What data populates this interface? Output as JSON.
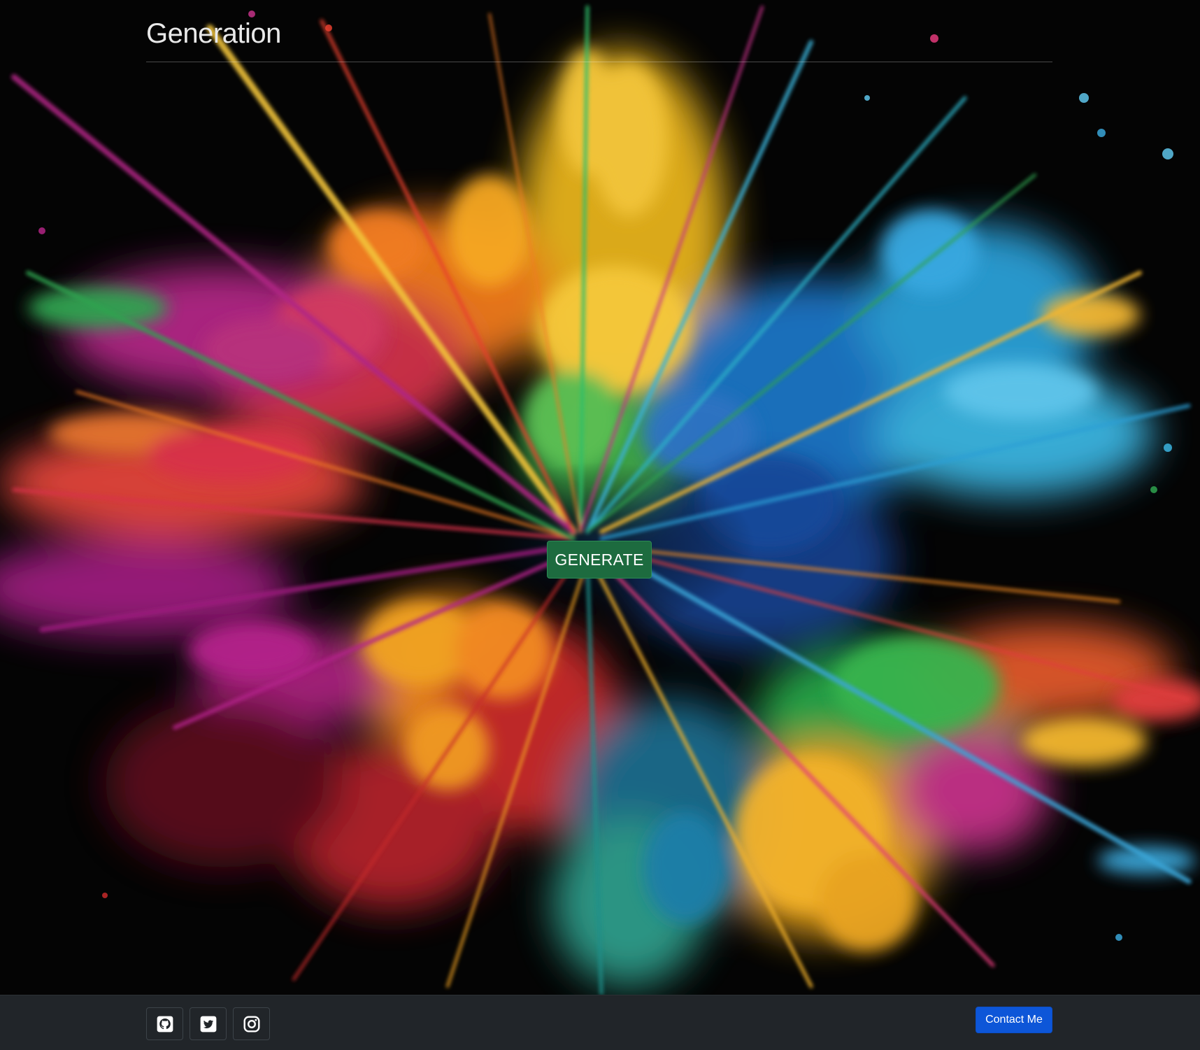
{
  "header": {
    "title": "Generation"
  },
  "hero": {
    "generate_label": "GENERATE",
    "background": "color-explosion-artwork"
  },
  "footer": {
    "social": [
      {
        "icon": "github-icon"
      },
      {
        "icon": "twitter-icon"
      },
      {
        "icon": "instagram-icon"
      }
    ],
    "contact_label": "Contact Me"
  },
  "colors": {
    "generate_bg": "#1d6b3f",
    "contact_bg": "#0d56d8",
    "footer_bg": "#212529"
  }
}
